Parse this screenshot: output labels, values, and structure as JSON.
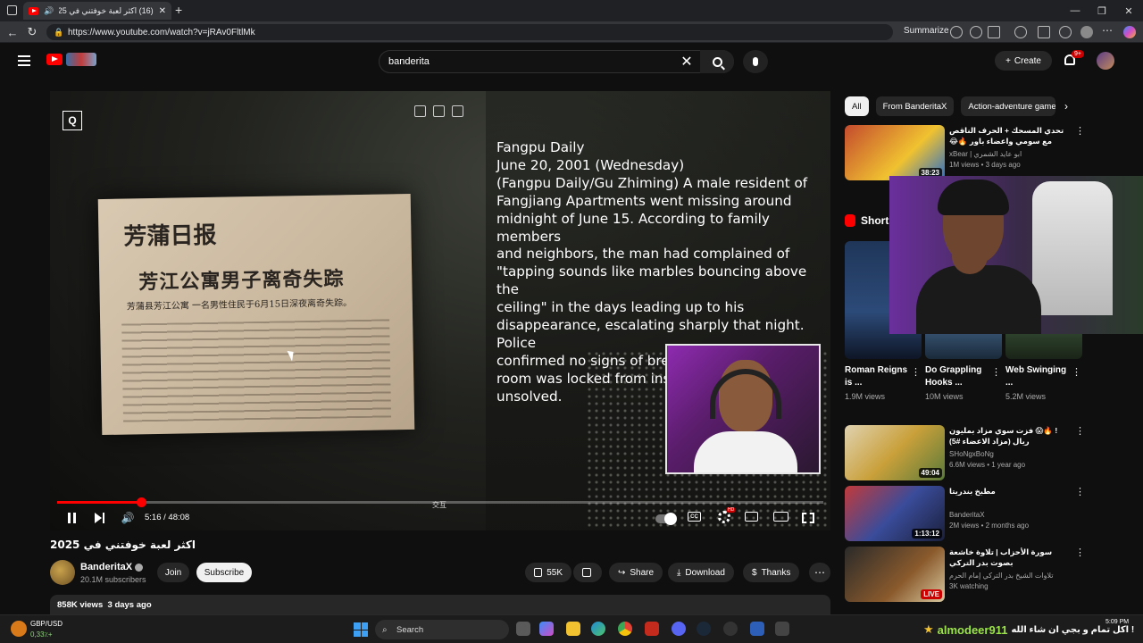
{
  "browser": {
    "tab_title": "(16) اكثر لعبة خوفتني في 2025",
    "url": "https://www.youtube.com/watch?v=jRAv0FltlMk",
    "summarize_label": "Summarize"
  },
  "header": {
    "search_value": "banderita",
    "create_label": "Create",
    "notif_count": "9+"
  },
  "player": {
    "story_lines": [
      "Fangpu Daily",
      "June 20, 2001 (Wednesday)",
      "(Fangpu Daily/Gu Zhiming) A male resident of",
      "Fangjiang Apartments went missing around",
      "midnight of June 15. According to family members",
      "and neighbors, the man had complained of",
      "\"tapping sounds like marbles bouncing above the",
      "ceiling\" in the days leading up to his",
      "disappearance, escalating sharply that night. Police",
      "confirmed no signs of break-in or struggle—his",
      "room was locked from inside. The case remains",
      "unsolved."
    ],
    "paper_masthead": "芳蒲日报",
    "paper_headline": "芳江公寓男子离奇失踪",
    "paper_subline": "芳蒲县芳江公寓 一名男性住民于6月15日深夜离奇失踪。",
    "chapter_label": "交互",
    "time_current": "5:16",
    "time_total": "48:08",
    "progress": 0.109,
    "q_badge": "Q",
    "cc_label": "CC",
    "hd_badge": "HD"
  },
  "video": {
    "title": "اكثر لعبة خوفتني في 2025",
    "channel": "BanderitaX",
    "subscribers": "20.1M subscribers",
    "join_label": "Join",
    "subscribe_label": "Subscribe",
    "likes": "55K",
    "share_label": "Share",
    "download_label": "Download",
    "thanks_label": "Thanks",
    "views": "858K views",
    "age": "3 days ago"
  },
  "sidebar": {
    "chips": [
      "All",
      "From BanderitaX",
      "Action-adventure game"
    ],
    "shorts_label": "Shorts",
    "recs_top": [
      {
        "title": "تحدي المسحك + الحرف الناقص مع سومي واعضاء باور 🔥😂",
        "channel": "xBear | ابو عايد الشمري",
        "meta": "1M views • 3 days ago",
        "duration": "38:23",
        "color": "#b23a2e"
      }
    ],
    "shorts": [
      {
        "title": "Roman Reigns is ...",
        "views": "1.9M views",
        "color": "#2c4a78"
      },
      {
        "title": "Do Grappling Hooks ...",
        "views": "10M views",
        "color": "#4a6e96"
      },
      {
        "title": "Web Swinging ...",
        "views": "5.2M views",
        "color": "#3e5a3c"
      }
    ],
    "recs_bottom": [
      {
        "title": "! 🔥😱 فزت سوي مزاد بمليون ريال (مزاد الاعضاء #5)",
        "channel": "SHoNgxBoNg",
        "meta": "6.6M views • 1 year ago",
        "duration": "49:04",
        "color": "#c9a03a"
      },
      {
        "title": "مطبخ بندريتا",
        "channel": "BanderitaX",
        "meta": "2M views • 2 months ago",
        "duration": "1:13:12",
        "color": "#3a4c9a"
      },
      {
        "title": "سورة الأحزاب | تلاوة خاشعة بصوت بدر التركي",
        "channel": "تلاوات الشيخ بدر التركي إمام الحرم",
        "meta": "3K watching",
        "live": "LIVE",
        "color": "#8a5a2c"
      }
    ]
  },
  "taskbar": {
    "fx_pair": "GBP/USD",
    "fx_value": "0,33٪+",
    "search_label": "Search",
    "ticker_user": "almodeer911",
    "ticker_text": "اكل تمام و بجي ان شاء الله !",
    "clock": "5:09 PM"
  },
  "colors": {
    "accent": "#ff0000",
    "bg": "#0f0f0f",
    "surface": "#272727"
  }
}
